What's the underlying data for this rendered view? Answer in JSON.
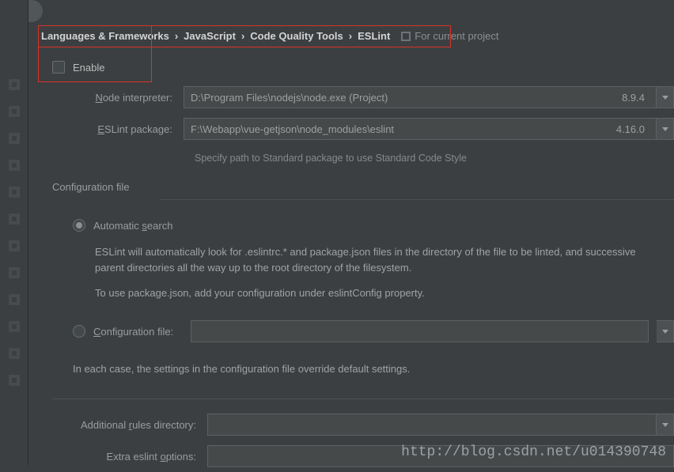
{
  "breadcrumb": [
    "Languages & Frameworks",
    "JavaScript",
    "Code Quality Tools",
    "ESLint"
  ],
  "forProjectLabel": "For current project",
  "enable": {
    "label": "Enable",
    "checked": false
  },
  "nodeInterpreter": {
    "label": "Node interpreter:",
    "value": "D:\\Program Files\\nodejs\\node.exe  (Project)",
    "version": "8.9.4"
  },
  "eslintPackage": {
    "label": "ESLint package:",
    "value": "F:\\Webapp\\vue-getjson\\node_modules\\eslint",
    "version": "4.16.0"
  },
  "packageHint": "Specify path to Standard package to use Standard Code Style",
  "configSection": {
    "title": "Configuration file",
    "autoLabel": "Automatic search",
    "autoDesc1": "ESLint will automatically look for .eslintrc.* and package.json files in the directory of the file to be linted, and successive parent directories all the way up to the root directory of the filesystem.",
    "autoDesc2": "To use package.json, add your configuration under eslintConfig property.",
    "fileLabel": "Configuration file:",
    "fileValue": ""
  },
  "overrideNote": "In each case, the settings in the configuration file override default settings.",
  "rulesDir": {
    "label": "Additional rules directory:",
    "value": ""
  },
  "extraOptions": {
    "label": "Extra eslint options:",
    "value": ""
  },
  "watermark": "http://blog.csdn.net/u014390748"
}
